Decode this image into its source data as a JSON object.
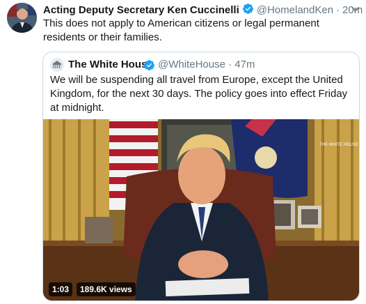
{
  "tweet": {
    "author_name": "Acting Deputy Secretary Ken Cuccinelli",
    "handle": "@HomelandKen",
    "separator": "·",
    "time": "20m",
    "text": "This does not apply to American citizens or legal permanent residents or their families.",
    "verified_icon": "verified-badge-icon",
    "menu_icon": "chevron-down-icon"
  },
  "quoted_tweet": {
    "author_name": "The White House",
    "handle": "@WhiteHouse",
    "separator": "·",
    "time": "47m",
    "text": "We will be suspending all travel from Europe, except the United Kingdom, for the next 30 days. The policy goes into effect Friday at midnight.",
    "video": {
      "duration": "1:03",
      "views": "189.6K views",
      "watermark": "THE WHITE HOUSE"
    }
  },
  "colors": {
    "accent": "#1da1f2",
    "secondary_text": "#657786",
    "border": "#ccd6dd"
  }
}
